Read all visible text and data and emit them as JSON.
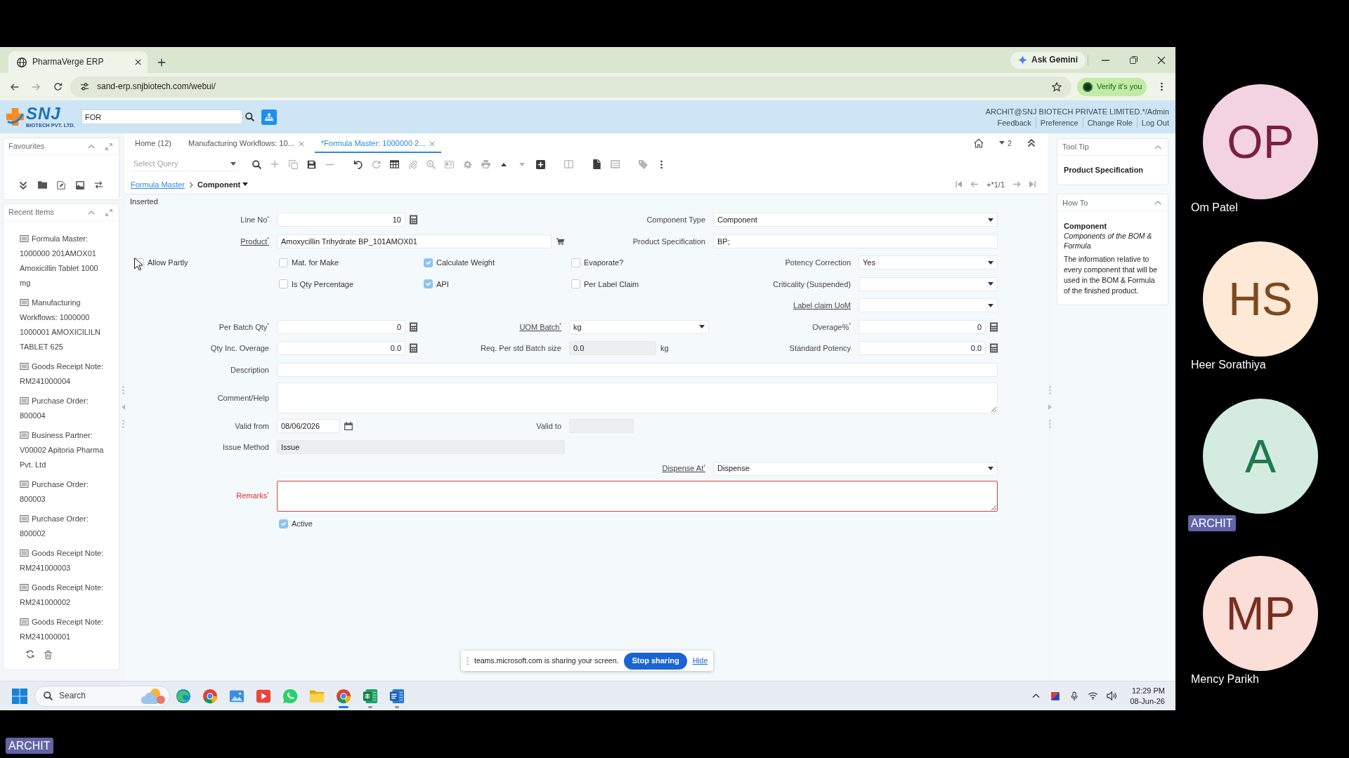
{
  "browser": {
    "tabs": [
      {
        "title": "PharmaVerge ERP",
        "selected": true
      }
    ],
    "gemini_button": "Ask Gemini",
    "address": "sand-erp.snjbiotech.com/webui/",
    "verify_button": "Verify it's you"
  },
  "app_header": {
    "logo": {
      "wordmark": "SNJ",
      "tagline": "BIOTECH PVT. LTD."
    },
    "search": {
      "value": "FOR"
    },
    "user": "ARCHIT@SNJ BIOTECH PRIVATE LIMITED.*/Admin",
    "links": [
      "Feedback",
      "Preference",
      "Change Role",
      "Log Out"
    ]
  },
  "sidebar": {
    "favourites": {
      "title": "Favourites"
    },
    "recent_items": {
      "title": "Recent Items",
      "items": [
        "Formula Master: 1000000 201AMOX01 Amoxicillin Tablet 1000 mg",
        "Manufacturing Workflows: 1000000 1000001 AMOXICILILN TABLET 625",
        "Goods Receipt Note: RM241000004",
        "Purchase Order: 800004",
        "Business Partner: V00002 Apitoria Pharma Pvt. Ltd",
        "Purchase Order: 800003",
        "Purchase Order: 800002",
        "Goods Receipt Note: RM241000003",
        "Goods Receipt Note: RM241000002",
        "Goods Receipt Note: RM241000001"
      ]
    }
  },
  "window_tabs": [
    {
      "label": "Home (12)",
      "closable": false,
      "selected": false
    },
    {
      "label": "Manufacturing Workflows: 10...",
      "closable": true,
      "selected": false
    },
    {
      "label": "*Formula Master: 1000000 2...",
      "closable": true,
      "selected": true
    }
  ],
  "notice_count": "2",
  "query_select": {
    "placeholder": "Select Query"
  },
  "breadcrumb": {
    "parent": "Formula Master",
    "current": "Component"
  },
  "record_position": "+*1/1",
  "status": "Inserted",
  "form": {
    "rows": [
      [
        {
          "kind": "number",
          "label": "Line No$^{*}$",
          "link": false,
          "error": false,
          "value": "10"
        },
        {
          "kind": "select",
          "label": "Component Type",
          "link": false,
          "error": false,
          "value": "Component"
        }
      ],
      [
        {
          "kind": "lookup",
          "label": "Product$^{*}$",
          "link": true,
          "error": false,
          "value": "Amoxycillin Trihydrate BP_101AMOX01"
        },
        {
          "kind": "text",
          "label": "Product Specification",
          "link": false,
          "error": false,
          "value": "BP;"
        }
      ],
      [
        {
          "kind": "checkbox",
          "label": "Allow Partly",
          "checked": false
        },
        {
          "kind": "checkbox",
          "label": "Mat. for Make",
          "checked": false
        },
        {
          "kind": "checkbox",
          "label": "Calculate Weight",
          "checked": true
        },
        {
          "kind": "checkbox",
          "label": "Evaporate?",
          "checked": false
        },
        {
          "kind": "select",
          "label": "Potency Correction",
          "link": false,
          "error": false,
          "value": "Yes"
        }
      ],
      [
        "",
        {
          "kind": "checkbox",
          "label": "Is Qty Percentage",
          "checked": false
        },
        {
          "kind": "checkbox",
          "label": "API",
          "checked": true
        },
        {
          "kind": "checkbox",
          "label": "Per Label Claim",
          "checked": false
        },
        {
          "kind": "select",
          "label": "Criticality (Suspended)",
          "link": false,
          "error": false
        }
      ],
      [
        "",
        "",
        "",
        "",
        {
          "kind": "select",
          "label": "Label claim UoM",
          "link": true,
          "error": false
        }
      ],
      [
        {
          "kind": "number",
          "label": "Per Batch Qty$^{*}$",
          "link": false,
          "error": false,
          "value": "0"
        },
        {
          "kind": "select",
          "label": "UOM Batch$^{*}$",
          "link": true,
          "error": false,
          "value": "kg"
        },
        {
          "kind": "number",
          "label": "Overage%$^{*}$",
          "link": false,
          "error": false,
          "value": "0"
        }
      ],
      [
        {
          "kind": "number",
          "label": "Qty Inc. Overage",
          "link": false,
          "error": false,
          "value": "0.0"
        },
        {
          "kind": "readonly",
          "label": "Req. Per std Batch size",
          "link": false,
          "error": false,
          "value": "0.0",
          "unit": "kg"
        },
        {
          "kind": "number",
          "label": "Standard Potency",
          "link": false,
          "error": false,
          "value": "0.0"
        }
      ],
      [
        {
          "kind": "text",
          "label": "Description",
          "link": false,
          "error": false
        }
      ],
      [
        {
          "kind": "textarea",
          "label": "Comment/Help",
          "link": false,
          "error": false
        }
      ],
      [
        {
          "kind": "date",
          "label": "Valid from",
          "link": false,
          "error": false,
          "value": "08/06/2026"
        },
        {
          "kind": "readonly",
          "label": "Valid to",
          "link": false,
          "error": false
        }
      ],
      [
        {
          "kind": "readonly",
          "label": "Issue Method",
          "link": false,
          "error": false,
          "value": "Issue"
        }
      ],
      [
        {
          "kind": "select",
          "label": "Dispense At$^{*}$",
          "link": true,
          "error": false,
          "value": "Dispense"
        }
      ],
      [
        {
          "kind": "textarea",
          "label": "Remarks$^{*}$",
          "link": false,
          "error": true
        }
      ],
      [
        "",
        {
          "kind": "checkbox",
          "label": "Active",
          "checked": true
        }
      ]
    ]
  },
  "tool_tip": {
    "title": "Tool Tip",
    "text": "Product Specification"
  },
  "how_to": {
    "title": "How To",
    "heading": "Component",
    "subtitle": "Components of the BOM & Formula",
    "text": "The information relative to every component that will be used in the BOM & Formula of the finished product."
  },
  "share_bar": {
    "message": "teams.microsoft.com is sharing your screen.",
    "stop_button": "Stop sharing",
    "hide_link": "Hide"
  },
  "taskbar": {
    "search_placeholder": "Search",
    "apps": [
      {
        "running": false,
        "selected": false
      },
      {
        "running": false,
        "selected": false
      },
      {
        "running": false,
        "selected": false
      },
      {
        "running": false,
        "selected": false
      },
      {
        "running": false,
        "selected": false
      },
      {
        "running": false,
        "selected": false
      },
      {
        "running": true,
        "selected": true
      },
      {
        "running": true,
        "selected": false
      },
      {
        "running": true,
        "selected": false
      }
    ],
    "time": "12:29 PM",
    "date": "08-Jun-26"
  },
  "participants": [
    {
      "initials": "OP",
      "name": "Om Patel",
      "kind": "name",
      "color": "#f4d3e0"
    },
    {
      "initials": "HS",
      "name": "Heer Sorathiya",
      "kind": "name",
      "color": "#fde9d6"
    },
    {
      "initials": "A",
      "name": "ARCHIT",
      "kind": "badge",
      "color": "#d4ece0"
    },
    {
      "initials": "MP",
      "name": "Mency Parikh",
      "kind": "name",
      "color": "#fbded8"
    }
  ],
  "presenter_label": "ARCHIT"
}
